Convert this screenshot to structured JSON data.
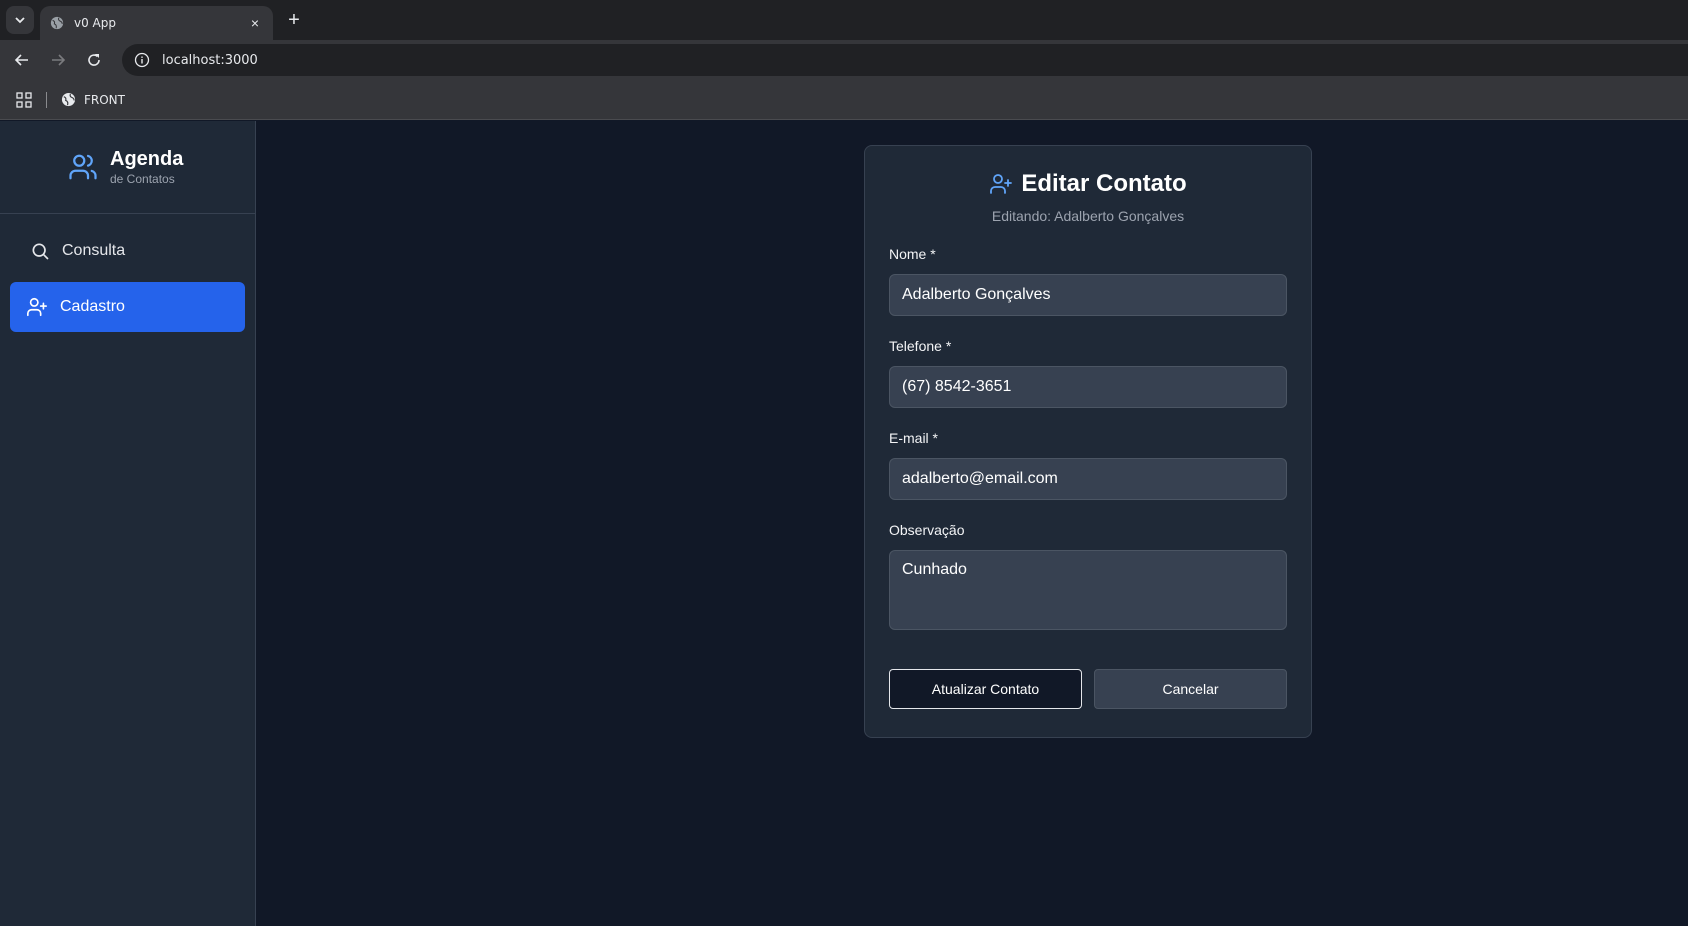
{
  "browser": {
    "tab_title": "v0 App",
    "tab_close": "×",
    "new_tab": "+",
    "url": "localhost:3000",
    "bookmark": "FRONT"
  },
  "sidebar": {
    "brand_title": "Agenda",
    "brand_subtitle": "de Contatos",
    "items": [
      {
        "label": "Consulta",
        "icon": "search-icon",
        "active": false
      },
      {
        "label": "Cadastro",
        "icon": "user-plus-icon",
        "active": true
      }
    ]
  },
  "form": {
    "title": "Editar Contato",
    "subtitle": "Editando: Adalberto Gonçalves",
    "fields": {
      "nome": {
        "label": "Nome *",
        "value": "Adalberto Gonçalves"
      },
      "telefone": {
        "label": "Telefone *",
        "value": "(67) 8542-3651"
      },
      "email": {
        "label": "E-mail *",
        "value": "adalberto@email.com"
      },
      "observacao": {
        "label": "Observação",
        "value": "Cunhado"
      }
    },
    "submit_label": "Atualizar Contato",
    "cancel_label": "Cancelar"
  },
  "colors": {
    "accent": "#2563eb",
    "background": "#111827",
    "panel": "#1f2937",
    "icon_blue": "#60a5fa"
  }
}
